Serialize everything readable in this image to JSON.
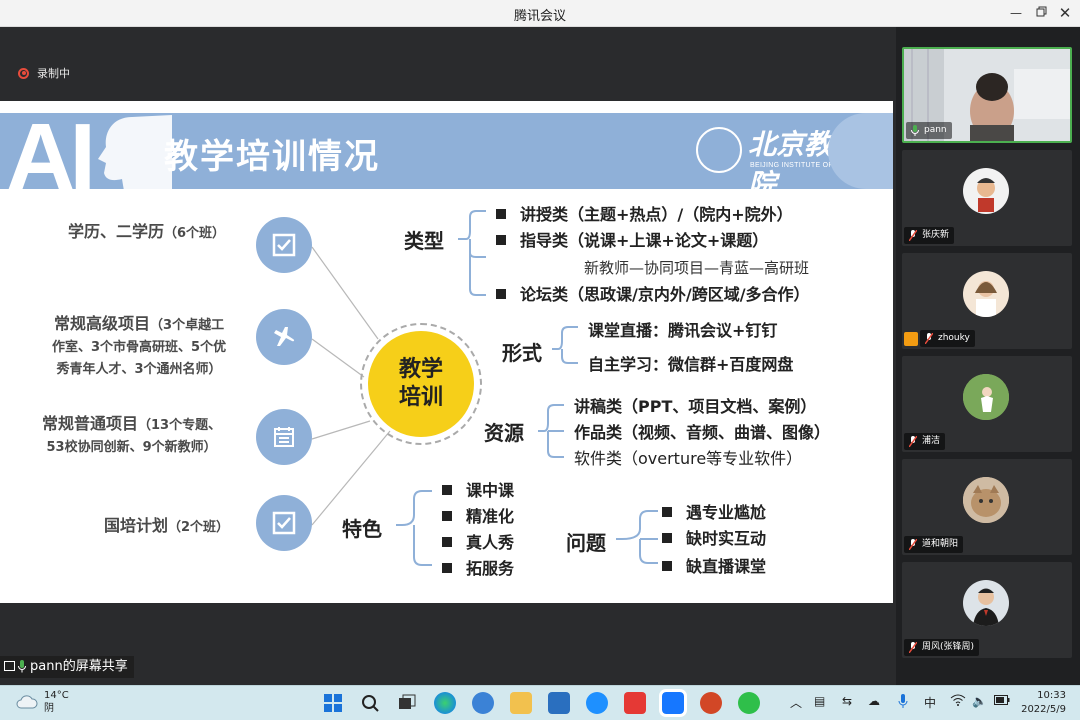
{
  "window": {
    "title": "腾讯会议"
  },
  "recording": {
    "label": "录制中"
  },
  "slide": {
    "title": "教学培训情况",
    "logo_cn": "北京教育学院",
    "logo_en": "BEIJING INSTITUTE OF EDUCATION",
    "left_items": [
      {
        "main": "学历、二学历",
        "note": "（6个班）"
      },
      {
        "main": "常规高级项目",
        "note": "（3个卓越工",
        "line2": "作室、3个市骨高研班、5个优",
        "line3": "秀青年人才、3个通州名师）"
      },
      {
        "main": "常规普通项目",
        "note": "（13个专题、",
        "line2": "53校协同创新、9个新教师）"
      },
      {
        "main": "国培计划",
        "note": "（2个班）"
      }
    ],
    "center": {
      "line1": "教学",
      "line2": "培训"
    },
    "types": {
      "label": "类型",
      "items": [
        "讲授类（主题+热点）/（院内+院外）",
        "指导类（说课+上课+论文+课题）",
        "论坛类（思政课/京内外/跨区域/多合作）"
      ],
      "note": "新教师—协同项目—青蓝—高研班"
    },
    "forms": {
      "label": "形式",
      "items": [
        "课堂直播：腾讯会议+钉钉",
        "自主学习：微信群+百度网盘"
      ]
    },
    "resources": {
      "label": "资源",
      "items": [
        "讲稿类（PPT、项目文档、案例）",
        "作品类（视频、音频、曲谱、图像）",
        "软件类（overture等专业软件）"
      ]
    },
    "features": {
      "label": "特色",
      "items": [
        "课中课",
        "精准化",
        "真人秀",
        "拓服务"
      ]
    },
    "problems": {
      "label": "问题",
      "items": [
        "遇专业尴尬",
        "缺时实互动",
        "缺直播课堂"
      ]
    }
  },
  "share_label": "pann的屏幕共享",
  "participants": [
    {
      "name": "pann"
    },
    {
      "name": "张庆新"
    },
    {
      "name": "zhouky"
    },
    {
      "name": "浦洁"
    },
    {
      "name": "道和朝阳"
    },
    {
      "name": "周风(张锋周)"
    }
  ],
  "taskbar": {
    "weather_temp": "14°C",
    "weather_desc": "阴",
    "ime": "中",
    "time": "10:33",
    "date": "2022/5/9"
  },
  "colors": {
    "accent_blue": "#8fb0d8",
    "center_yellow": "#f6cf19",
    "active_green": "#4caf50"
  }
}
